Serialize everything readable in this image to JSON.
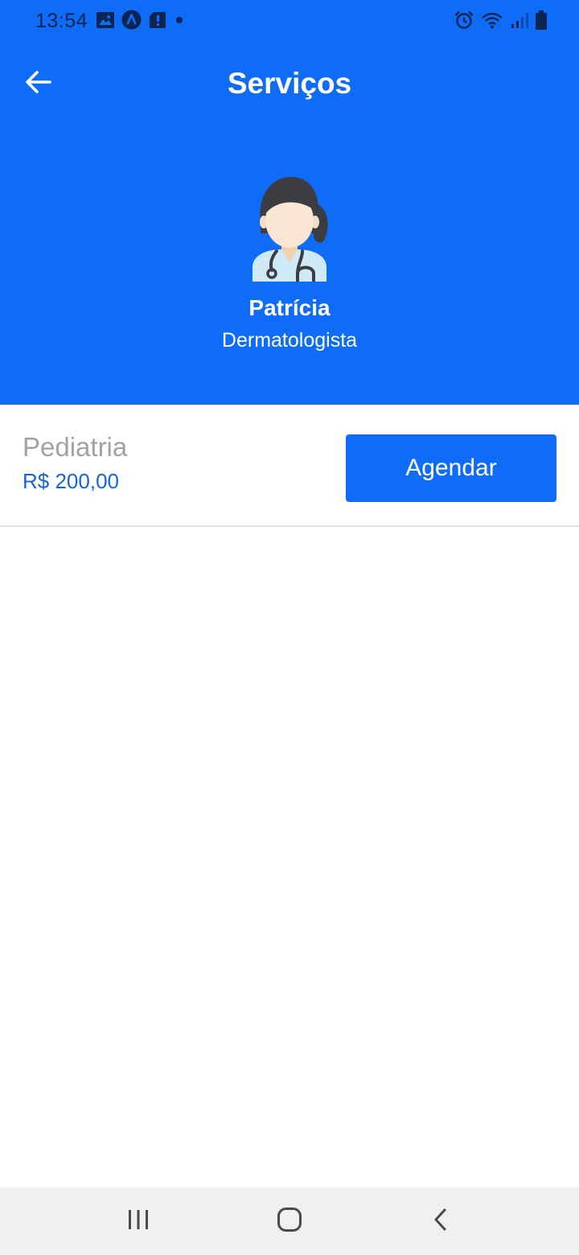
{
  "status_bar": {
    "time": "13:54"
  },
  "header": {
    "title": "Serviços",
    "background_color": "#0f6cf7"
  },
  "doctor": {
    "name": "Patrícia",
    "specialty": "Dermatologista"
  },
  "services": [
    {
      "name": "Pediatria",
      "price": "R$ 200,00",
      "action_label": "Agendar"
    }
  ],
  "icons": {
    "status_left": [
      "gallery-icon",
      "app-notification-icon",
      "sd-card-alert-icon",
      "dot-icon"
    ],
    "status_right": [
      "alarm-icon",
      "wifi-icon",
      "cellular-signal-icon",
      "battery-icon"
    ],
    "navigation": [
      "recent-apps-icon",
      "home-icon",
      "back-nav-icon"
    ]
  },
  "colors": {
    "primary": "#0f6cf7",
    "price": "#1565d8",
    "service_name": "#a2a2a2",
    "divider": "#e3e3e3",
    "nav_bar": "#f0f0f0"
  }
}
